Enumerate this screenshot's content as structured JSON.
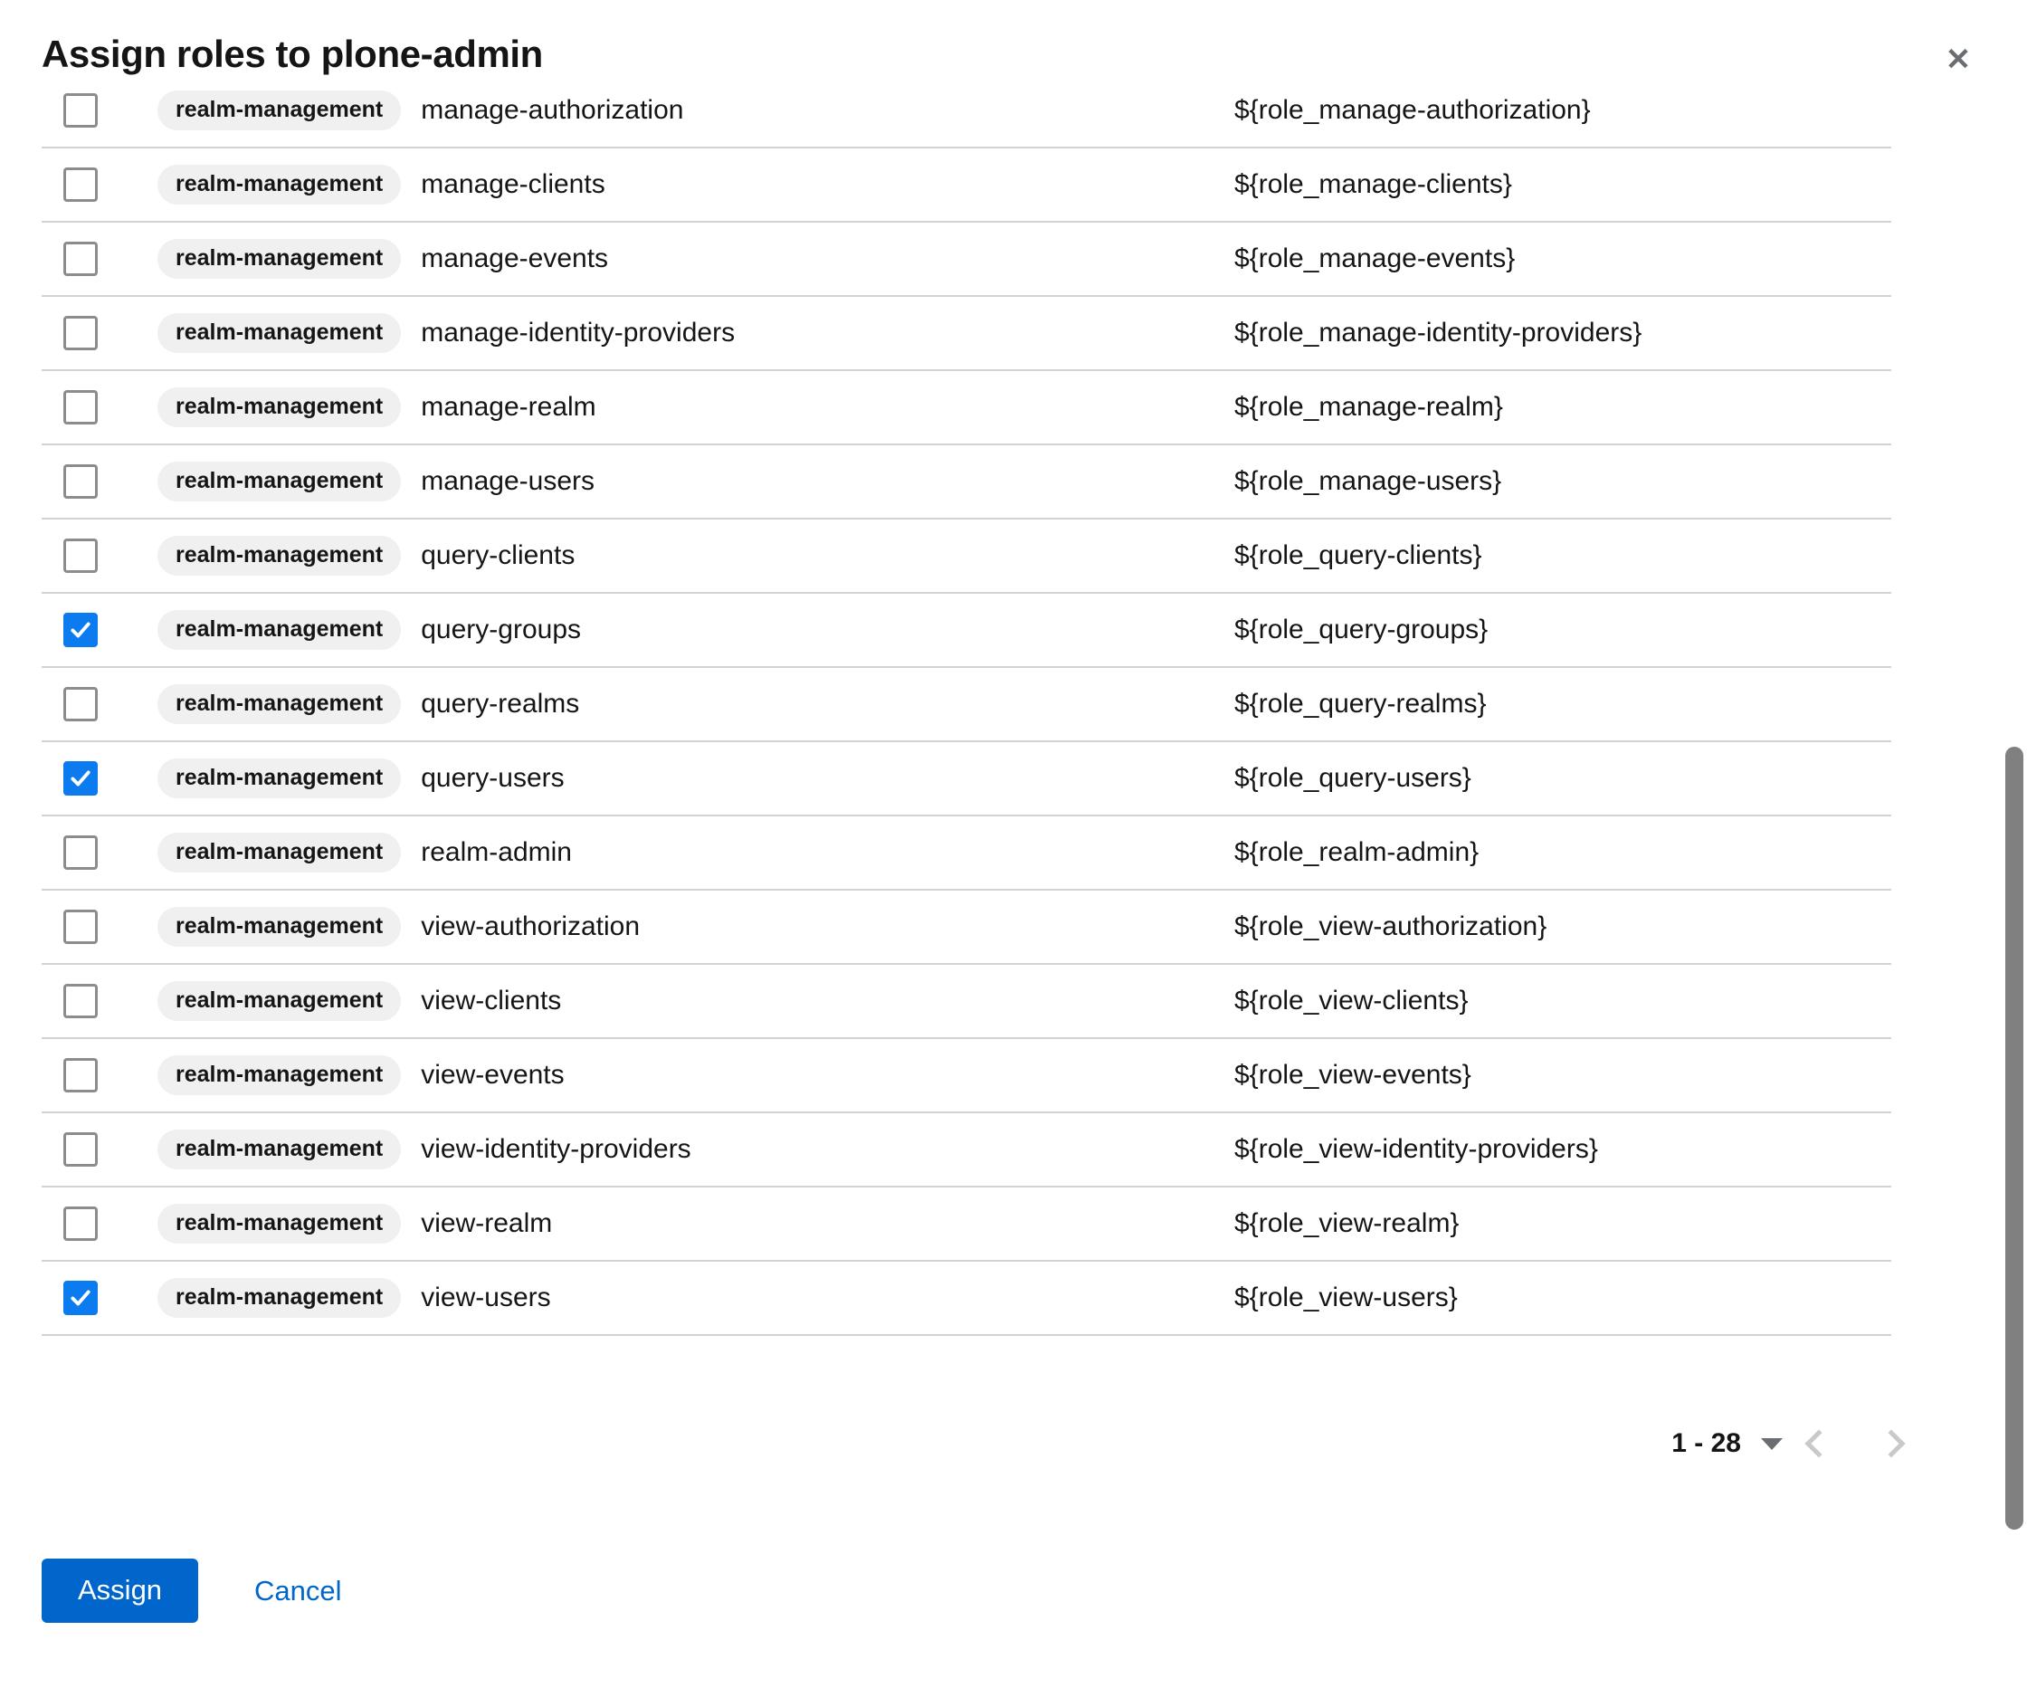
{
  "dialog": {
    "title": "Assign roles to plone-admin",
    "close_icon": "close-icon"
  },
  "table": {
    "rows": [
      {
        "checked": false,
        "client": "realm-management",
        "name": "manage-authorization",
        "description": "${role_manage-authorization}"
      },
      {
        "checked": false,
        "client": "realm-management",
        "name": "manage-clients",
        "description": "${role_manage-clients}"
      },
      {
        "checked": false,
        "client": "realm-management",
        "name": "manage-events",
        "description": "${role_manage-events}"
      },
      {
        "checked": false,
        "client": "realm-management",
        "name": "manage-identity-providers",
        "description": "${role_manage-identity-providers}"
      },
      {
        "checked": false,
        "client": "realm-management",
        "name": "manage-realm",
        "description": "${role_manage-realm}"
      },
      {
        "checked": false,
        "client": "realm-management",
        "name": "manage-users",
        "description": "${role_manage-users}"
      },
      {
        "checked": false,
        "client": "realm-management",
        "name": "query-clients",
        "description": "${role_query-clients}"
      },
      {
        "checked": true,
        "client": "realm-management",
        "name": "query-groups",
        "description": "${role_query-groups}"
      },
      {
        "checked": false,
        "client": "realm-management",
        "name": "query-realms",
        "description": "${role_query-realms}"
      },
      {
        "checked": true,
        "client": "realm-management",
        "name": "query-users",
        "description": "${role_query-users}"
      },
      {
        "checked": false,
        "client": "realm-management",
        "name": "realm-admin",
        "description": "${role_realm-admin}"
      },
      {
        "checked": false,
        "client": "realm-management",
        "name": "view-authorization",
        "description": "${role_view-authorization}"
      },
      {
        "checked": false,
        "client": "realm-management",
        "name": "view-clients",
        "description": "${role_view-clients}"
      },
      {
        "checked": false,
        "client": "realm-management",
        "name": "view-events",
        "description": "${role_view-events}"
      },
      {
        "checked": false,
        "client": "realm-management",
        "name": "view-identity-providers",
        "description": "${role_view-identity-providers}"
      },
      {
        "checked": false,
        "client": "realm-management",
        "name": "view-realm",
        "description": "${role_view-realm}"
      },
      {
        "checked": true,
        "client": "realm-management",
        "name": "view-users",
        "description": "${role_view-users}"
      }
    ]
  },
  "pagination": {
    "range_label": "1 - 28",
    "caret_icon": "chevron-down-icon",
    "prev_icon": "chevron-left-icon",
    "next_icon": "chevron-right-icon"
  },
  "footer": {
    "assign_label": "Assign",
    "cancel_label": "Cancel"
  },
  "colors": {
    "accent": "#0066cc",
    "checkbox_checked": "#0d7bf0",
    "chip_bg": "#f0f0f0",
    "divider": "#d2d2d2",
    "scrollbar_thumb": "#808080"
  }
}
